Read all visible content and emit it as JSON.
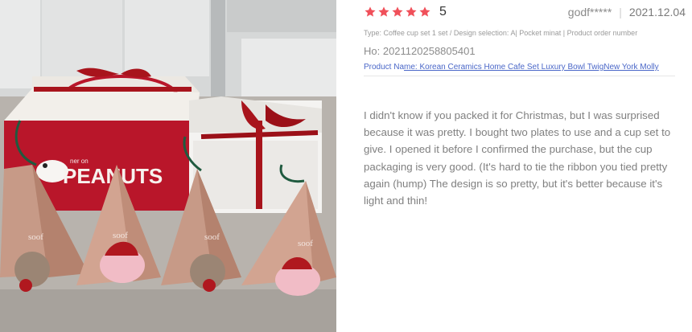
{
  "review": {
    "rating": 5,
    "rating_label": "5",
    "author": "godf*****",
    "date": "2021.12.04",
    "product_type": "Type: Coffee cup set 1 set / Design selection: A| Pocket minat | Product order number",
    "order_number": "Ho: 2021120258805401",
    "product_name_prefix": "Product Na",
    "product_name_link": "me: Korean Ceramics Home Cafe Set Luxury Bowl TwigNew York Molly",
    "body": "I didn't know if you packed it for Christmas, but I was surprised because it was pretty. I bought two plates to use and a cup set to give. I opened it before I confirmed the purchase, but the cup packaging is very good. (It's hard to tie the ribbon you tied pretty again (hump) The design is so pretty, but it's better because it's light and thin!"
  },
  "photo": {
    "box_label": "PEANUTS",
    "box_small": "ner on",
    "tag_brand": "soof"
  },
  "colors": {
    "star": "#f0505a",
    "link": "#4a67c8",
    "ribbon": "#a8141c",
    "box_red": "#b9162a"
  }
}
